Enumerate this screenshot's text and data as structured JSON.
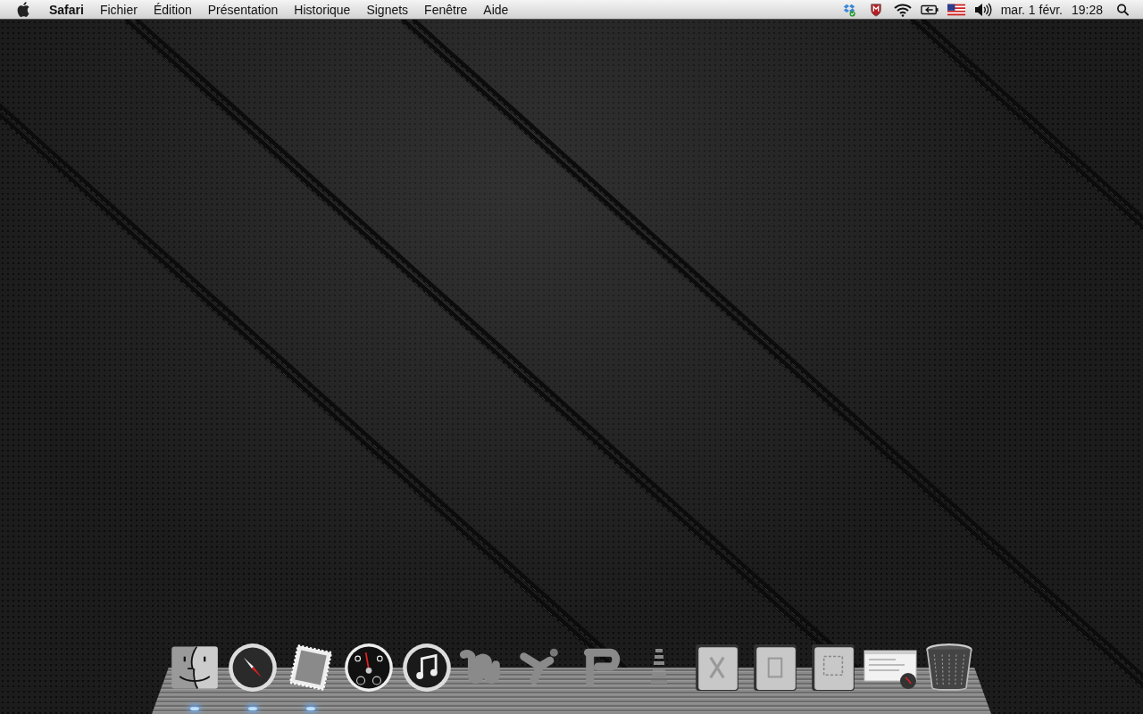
{
  "menu_bar": {
    "app_name": "Safari",
    "items": [
      "Fichier",
      "Édition",
      "Présentation",
      "Historique",
      "Signets",
      "Fenêtre",
      "Aide"
    ],
    "status_icons": [
      {
        "kind": "dropbox"
      },
      {
        "kind": "antivirus"
      },
      {
        "kind": "wifi"
      },
      {
        "kind": "battery"
      },
      {
        "kind": "flag"
      },
      {
        "kind": "volume"
      }
    ],
    "date": "mar. 1 févr.",
    "time": "19:28"
  },
  "dock": {
    "items": [
      {
        "kind": "finder",
        "running": true
      },
      {
        "kind": "safari",
        "running": true
      },
      {
        "kind": "mail",
        "running": true
      },
      {
        "kind": "dashboard",
        "running": false
      },
      {
        "kind": "itunes",
        "running": false
      },
      {
        "kind": "word",
        "running": false
      },
      {
        "kind": "excel",
        "running": false
      },
      {
        "kind": "powerpoint",
        "running": false
      },
      {
        "kind": "separator",
        "running": false
      },
      {
        "kind": "folder-x",
        "running": false
      },
      {
        "kind": "folder-doc",
        "running": false
      },
      {
        "kind": "folder-select",
        "running": false
      },
      {
        "kind": "window",
        "running": false
      },
      {
        "kind": "trash",
        "running": false
      }
    ]
  }
}
